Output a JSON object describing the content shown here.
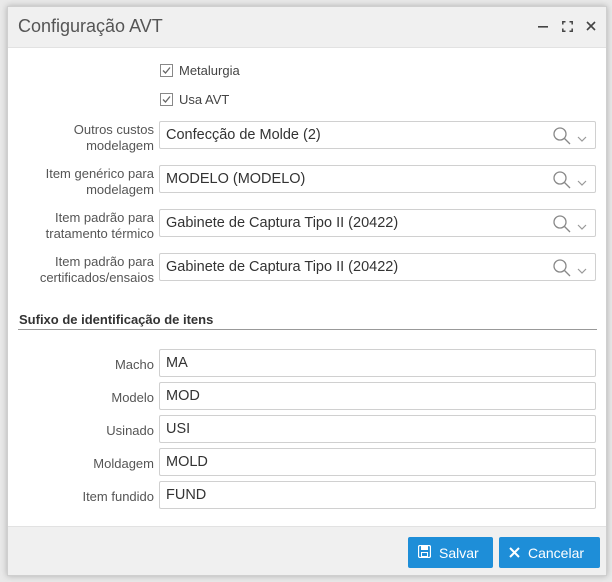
{
  "window": {
    "title": "Configuração AVT",
    "controls": [
      "minimize-icon",
      "maximize-icon",
      "close-icon"
    ]
  },
  "checkboxes": [
    {
      "label": "Metalurgia",
      "checked": true
    },
    {
      "label": "Usa AVT",
      "checked": true
    }
  ],
  "lookups": [
    {
      "label_lines": [
        "Outros custos",
        "modelagem"
      ],
      "value": "Confecção de Molde (2)"
    },
    {
      "label_lines": [
        "Item genérico para",
        "modelagem"
      ],
      "value": "MODELO (MODELO)"
    },
    {
      "label_lines": [
        "Item padrão para",
        "tratamento térmico"
      ],
      "value": "Gabinete de Captura Tipo II (20422)"
    },
    {
      "label_lines": [
        "Item padrão para",
        "certificados/ensaios"
      ],
      "value": "Gabinete de Captura Tipo II (20422)"
    }
  ],
  "section": {
    "title": "Sufixo de identificação de itens"
  },
  "suffixes": [
    {
      "label": "Macho",
      "value": "MA"
    },
    {
      "label": "Modelo",
      "value": "MOD"
    },
    {
      "label": "Usinado",
      "value": "USI"
    },
    {
      "label": "Moldagem",
      "value": "MOLD"
    },
    {
      "label": "Item fundido",
      "value": "FUND"
    }
  ],
  "footer": {
    "save_label": "Salvar",
    "cancel_label": "Cancelar"
  },
  "colors": {
    "accent": "#1e8ed8",
    "titlebar": "#f0f0f0"
  }
}
